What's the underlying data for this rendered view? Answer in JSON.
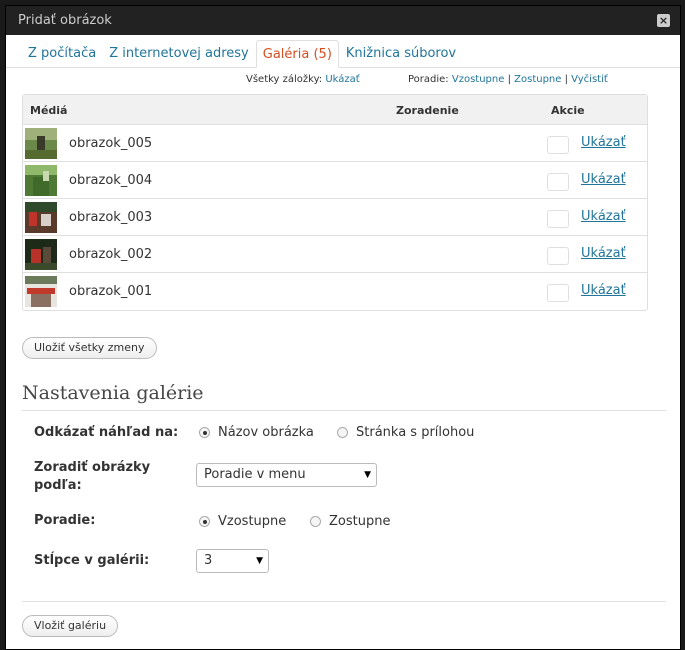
{
  "window": {
    "title": "Pridať obrázok",
    "close": "×"
  },
  "tabs": [
    {
      "label": "Z počítača"
    },
    {
      "label": "Z internetovej adresy"
    },
    {
      "label": "Galéria (5)"
    },
    {
      "label": "Knižnica súborov"
    }
  ],
  "filter": {
    "all_tabs_label": "Všetky záložky:",
    "all_tabs_link": "Ukázať",
    "order_label": "Poradie:",
    "asc": "Vzostupne",
    "desc": "Zostupne",
    "clear": "Vyčistiť",
    "sep": "|"
  },
  "table": {
    "headers": {
      "media": "Médiá",
      "order": "Zoradenie",
      "actions": "Akcie"
    },
    "rows": [
      {
        "title": "obrazok_005",
        "action": "Ukázať"
      },
      {
        "title": "obrazok_004",
        "action": "Ukázať"
      },
      {
        "title": "obrazok_003",
        "action": "Ukázať"
      },
      {
        "title": "obrazok_002",
        "action": "Ukázať"
      },
      {
        "title": "obrazok_001",
        "action": "Ukázať"
      }
    ]
  },
  "save_all_button": "Uložiť všetky zmeny",
  "gallery_settings": {
    "title": "Nastavenia galérie",
    "link_to": {
      "label": "Odkázať náhľad na:",
      "options": [
        "Názov obrázka",
        "Stránka s prílohou"
      ],
      "selected": "Názov obrázka"
    },
    "sort_by": {
      "label_line1": "Zoradiť obrázky",
      "label_line2": "podľa:",
      "value": "Poradie v menu"
    },
    "order": {
      "label": "Poradie:",
      "options": [
        "Vzostupne",
        "Zostupne"
      ],
      "selected": "Vzostupne"
    },
    "columns": {
      "label": "Stĺpce v galérii:",
      "value": "3"
    }
  },
  "insert_button": "Vložiť galériu",
  "icons": {
    "close": "close-icon",
    "dropdown": "chevron-down-icon"
  },
  "colors": {
    "link": "#21759b",
    "active_tab": "#d54e21",
    "titlebar": "#222222"
  }
}
